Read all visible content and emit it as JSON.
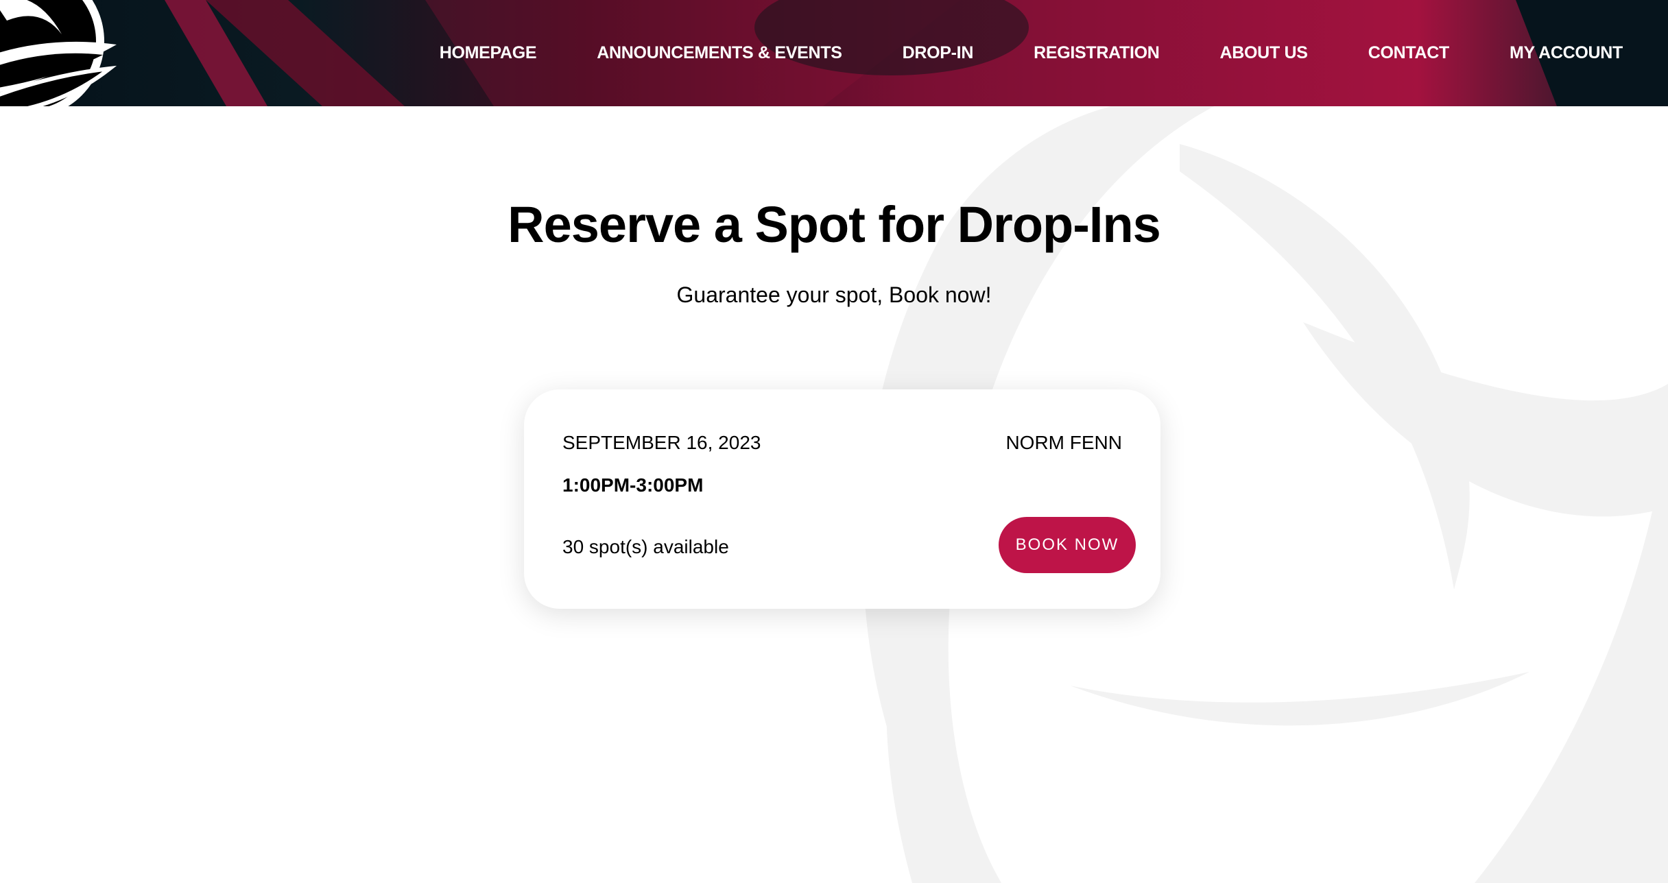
{
  "nav": {
    "items": [
      {
        "label": "HOMEPAGE"
      },
      {
        "label": "ANNOUNCEMENTS & EVENTS"
      },
      {
        "label": "DROP-IN"
      },
      {
        "label": "REGISTRATION"
      },
      {
        "label": "ABOUT US"
      },
      {
        "label": "CONTACT"
      },
      {
        "label": "MY ACCOUNT"
      }
    ]
  },
  "main": {
    "title": "Reserve a Spot for Drop-Ins",
    "subtitle": "Guarantee your spot, Book now!"
  },
  "session": {
    "date": "SEPTEMBER 16, 2023",
    "location": "NORM FENN",
    "time": "1:00PM-3:00PM",
    "spots": "30 spot(s) available",
    "book_label": "BOOK NOW"
  },
  "colors": {
    "accent": "#be1448",
    "header_dark": "#05121a",
    "header_red": "#a3123f"
  }
}
